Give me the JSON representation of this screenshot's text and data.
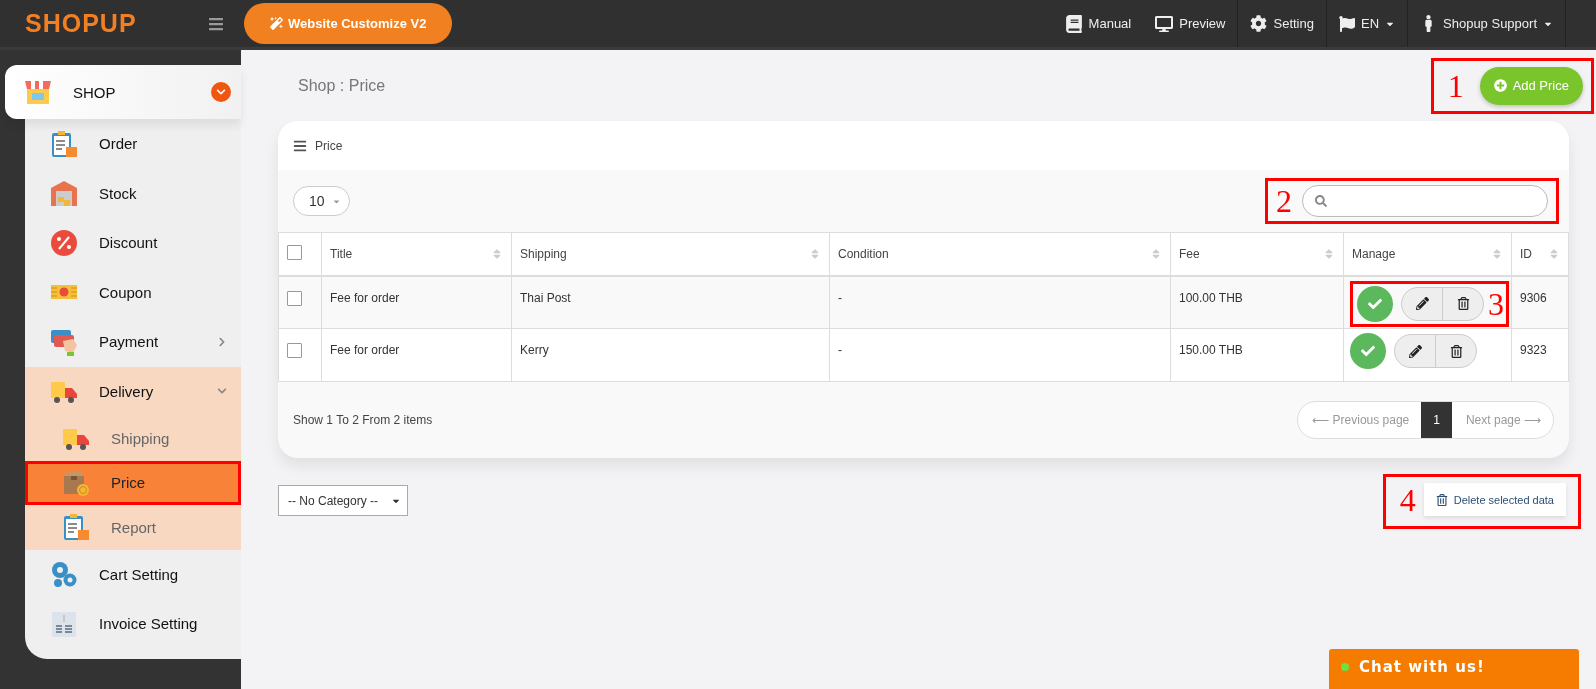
{
  "topbar": {
    "logo": "SHOPUP",
    "customize_button": "Website Customize V2",
    "menu": [
      {
        "label": "Manual",
        "kind": "link"
      },
      {
        "label": "Preview",
        "kind": "link"
      },
      {
        "label": "Setting",
        "kind": "link"
      },
      {
        "label": "EN",
        "kind": "dropdown"
      },
      {
        "label": "Shopup Support",
        "kind": "dropdown"
      }
    ]
  },
  "sidebar": {
    "section": {
      "label": "SHOP",
      "expanded": true
    },
    "items": [
      {
        "label": "Order",
        "selected": false
      },
      {
        "label": "Stock",
        "selected": false
      },
      {
        "label": "Discount",
        "selected": false
      },
      {
        "label": "Coupon",
        "selected": false
      },
      {
        "label": "Payment",
        "selected": false,
        "expanded": false
      },
      {
        "label": "Delivery",
        "selected": false,
        "expanded": true,
        "children": [
          {
            "label": "Shipping",
            "selected": false,
            "outlined": false
          },
          {
            "label": "Price",
            "selected": true,
            "outlined": true
          },
          {
            "label": "Report",
            "selected": false,
            "outlined": false
          }
        ]
      },
      {
        "label": "Cart Setting",
        "selected": false
      },
      {
        "label": "Invoice Setting",
        "selected": false
      }
    ]
  },
  "breadcrumb": "Shop : Price",
  "add_button": {
    "label": "Add Price",
    "callout": "1"
  },
  "panel": {
    "title": "Price",
    "page_size": "10",
    "search": {
      "callout": "2"
    },
    "all_checked": false,
    "columns": [
      "Title",
      "Shipping",
      "Condition",
      "Fee",
      "Manage",
      "ID"
    ],
    "rows": [
      {
        "checked": false,
        "title": "Fee for order",
        "shipping": "Thai Post",
        "condition": "-",
        "fee": "100.00 THB",
        "active": true,
        "id": "9306",
        "callout": "3"
      },
      {
        "checked": false,
        "title": "Fee for order",
        "shipping": "Kerry",
        "condition": "-",
        "fee": "150.00 THB",
        "active": true,
        "id": "9323"
      }
    ],
    "summary": "Show 1 To 2 From 2 items",
    "pagination": {
      "previous": "⟵ Previous page",
      "next": "Next page ⟶",
      "pages": [
        {
          "label": "1",
          "selected": true
        }
      ]
    }
  },
  "category_select": "-- No Category --",
  "delete_button": {
    "label": "Delete selected data",
    "callout": "4"
  },
  "chat": {
    "label": "Chat with us!",
    "online": true
  }
}
